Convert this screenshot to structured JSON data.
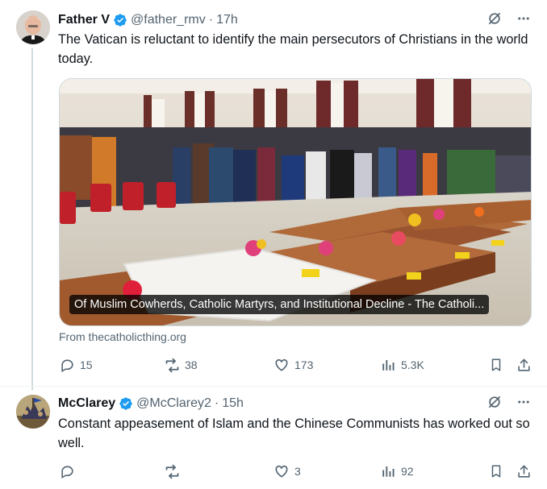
{
  "colors": {
    "accent": "#1d9bf0",
    "text": "#0f1419",
    "muted": "#536471"
  },
  "posts": [
    {
      "author": {
        "name": "Father V",
        "handle": "@father_rmv",
        "time": "17h",
        "verified": true
      },
      "text": "The Vatican is reluctant to identify the main persecutors of Christians in the world today.",
      "media": {
        "caption": "Of Muslim Cowherds, Catholic Martyrs, and Institutional Decline - The Catholi...",
        "source": "From thecatholicthing.org"
      },
      "actions": {
        "replies": "15",
        "reposts": "38",
        "likes": "173",
        "views": "5.3K"
      },
      "icons": [
        "grok-icon",
        "more-icon",
        "reply-icon",
        "repost-icon",
        "like-icon",
        "views-icon",
        "bookmark-icon",
        "share-icon"
      ]
    },
    {
      "author": {
        "name": "McClarey",
        "handle": "@McClarey2",
        "time": "15h",
        "verified": true
      },
      "text": "Constant appeasement of Islam and the Chinese Communists has worked out so well.",
      "actions": {
        "replies": "",
        "reposts": "",
        "likes": "3",
        "views": "92"
      }
    }
  ]
}
